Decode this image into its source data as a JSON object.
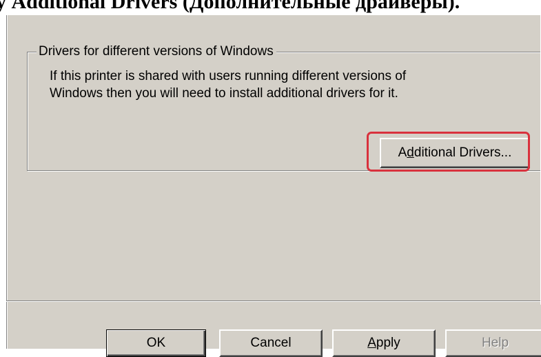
{
  "caption": {
    "prefix": "у ",
    "text": "Additional Drivers (Дополнительные драйверы)",
    "suffix": "."
  },
  "group": {
    "legend": "Drivers for different versions of Windows",
    "line1": "If this printer is shared with users running different versions of",
    "line2": "Windows then you will need to install additional drivers for it."
  },
  "additional_drivers_button": {
    "before": "A",
    "mnemonic": "d",
    "after": "ditional Drivers..."
  },
  "footer": {
    "ok": "OK",
    "cancel": "Cancel",
    "apply_mnemonic": "A",
    "apply_rest": "pply",
    "help": "Help"
  },
  "colors": {
    "dialog_face": "#d4d0c8",
    "highlight_ring": "#d9313d"
  }
}
